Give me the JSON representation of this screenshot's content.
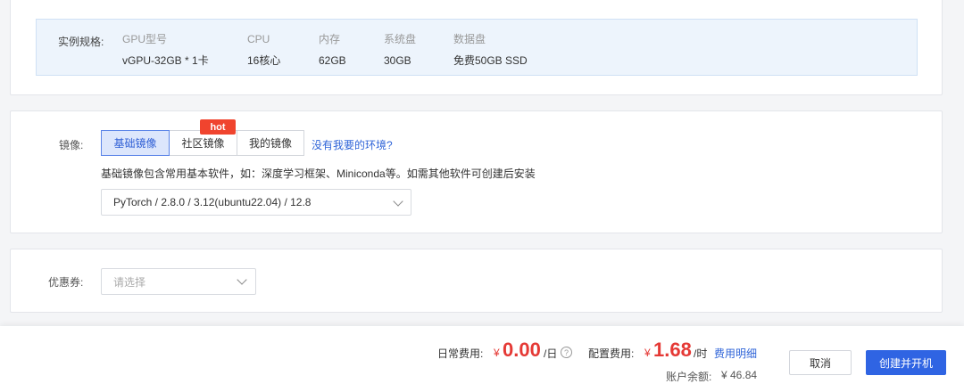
{
  "spec": {
    "label": "实例规格:",
    "columns": [
      {
        "header": "GPU型号",
        "value": "vGPU-32GB * 1卡"
      },
      {
        "header": "CPU",
        "value": "16核心"
      },
      {
        "header": "内存",
        "value": "62GB"
      },
      {
        "header": "系统盘",
        "value": "30GB"
      },
      {
        "header": "数据盘",
        "value": "免费50GB SSD"
      }
    ]
  },
  "image": {
    "label": "镜像:",
    "tabs": [
      {
        "label": "基础镜像",
        "active": true
      },
      {
        "label": "社区镜像",
        "active": false
      },
      {
        "label": "我的镜像",
        "active": false
      }
    ],
    "hot_badge": "hot",
    "missing_env_link": "没有我要的环境?",
    "hint": "基础镜像包含常用基本软件，如：深度学习框架、Miniconda等。如需其他软件可创建后安装",
    "selected": "PyTorch / 2.8.0 / 3.12(ubuntu22.04) / 12.8"
  },
  "coupon": {
    "label": "优惠券:",
    "placeholder": "请选择"
  },
  "footer": {
    "daily_label": "日常费用:",
    "daily_currency": "¥",
    "daily_value": "0.00",
    "daily_unit": "/日",
    "config_label": "配置费用:",
    "config_currency": "¥",
    "config_value": "1.68",
    "config_unit": "/时",
    "cost_detail_link": "费用明细",
    "balance_label": "账户余额:",
    "balance_value": "¥ 46.84",
    "cancel_label": "取消",
    "create_label": "创建并开机"
  },
  "colors": {
    "accent": "#2f64e3",
    "price": "#e53935",
    "hot": "#f0442e"
  }
}
